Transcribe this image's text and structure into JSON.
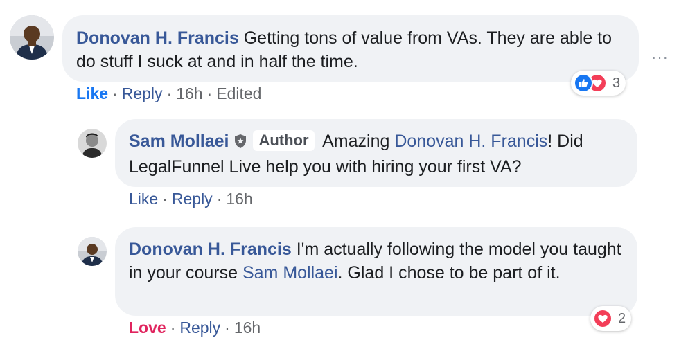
{
  "comment1": {
    "author": "Donovan H. Francis",
    "text": "Getting tons of value from VAs. They are able to do stuff I suck at and in half the time.",
    "actions": {
      "like": "Like",
      "reply": "Reply",
      "time": "16h",
      "edited": "Edited",
      "sep": "·"
    },
    "reactions": {
      "icons": [
        "like-icon",
        "love-icon"
      ],
      "count": "3"
    }
  },
  "reply1": {
    "author": "Sam Mollaei",
    "badge": "Author",
    "text_before": "Amazing ",
    "mention": "Donovan H. Francis",
    "text_after": "! Did LegalFunnel Live help you with hiring your first VA?",
    "actions": {
      "like": "Like",
      "reply": "Reply",
      "time": "16h",
      "sep": "·"
    }
  },
  "reply2": {
    "author": "Donovan H. Francis",
    "text_before": "I'm actually following the model you taught in your course ",
    "mention": "Sam Mollaei",
    "text_after": ". Glad I chose to be part of it.",
    "actions": {
      "love": "Love",
      "reply": "Reply",
      "time": "16h",
      "sep": "·"
    },
    "reactions": {
      "icons": [
        "love-icon"
      ],
      "count": "2"
    }
  },
  "more_options": "···",
  "colors": {
    "link": "#385898",
    "like_blue": "#1877f2",
    "love_red": "#e0245e",
    "bubble_bg": "#f0f2f5",
    "meta": "#65676b"
  }
}
